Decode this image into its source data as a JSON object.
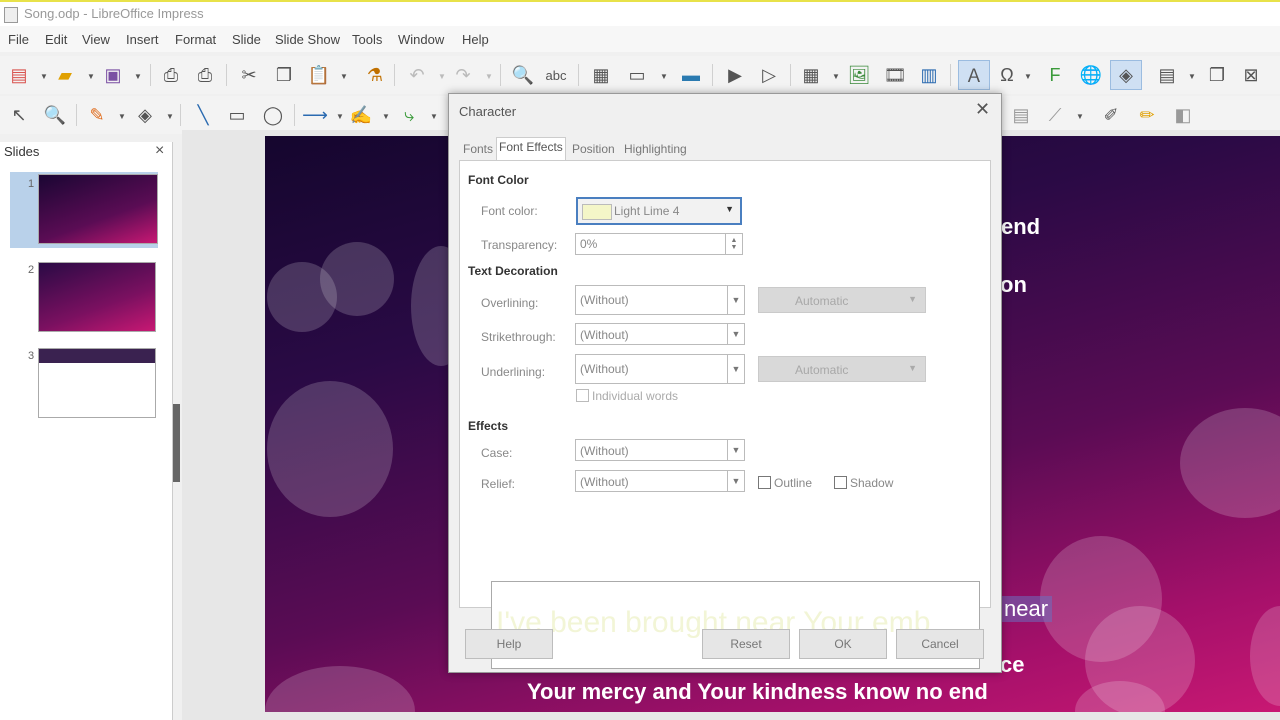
{
  "window": {
    "title": "Song.odp - LibreOffice Impress"
  },
  "menu": [
    "File",
    "Edit",
    "View",
    "Insert",
    "Format",
    "Slide",
    "Slide Show",
    "Tools",
    "Window",
    "Help"
  ],
  "slides_panel": {
    "title": "Slides",
    "close": "×",
    "numbers": [
      "1",
      "2",
      "3"
    ]
  },
  "slide": {
    "lines": [
      "end",
      "on",
      "near",
      "ce",
      "Your mercy and Your kindness know no end"
    ]
  },
  "dialog": {
    "title": "Character",
    "close": "✕",
    "tabs": [
      "Fonts",
      "Font Effects",
      "Position",
      "Highlighting"
    ],
    "sections": {
      "font_color": "Font Color",
      "text_decoration": "Text Decoration",
      "effects": "Effects"
    },
    "labels": {
      "font_color": "Font color:",
      "transparency": "Transparency:",
      "overlining": "Overlining:",
      "strikethrough": "Strikethrough:",
      "underlining": "Underlining:",
      "individual_words": "Individual words",
      "case": "Case:",
      "relief": "Relief:",
      "outline": "Outline",
      "shadow": "Shadow"
    },
    "values": {
      "font_color": "Light Lime 4",
      "font_color_swatch": "#f4f6c8",
      "transparency": "0%",
      "overlining": "(Without)",
      "overline_color": "Automatic",
      "strikethrough": "(Without)",
      "underlining": "(Without)",
      "underline_color": "Automatic",
      "case": "(Without)",
      "relief": "(Without)"
    },
    "preview_text": "I've been brought near Your emb",
    "buttons": {
      "help": "Help",
      "reset": "Reset",
      "ok": "OK",
      "cancel": "Cancel"
    }
  }
}
